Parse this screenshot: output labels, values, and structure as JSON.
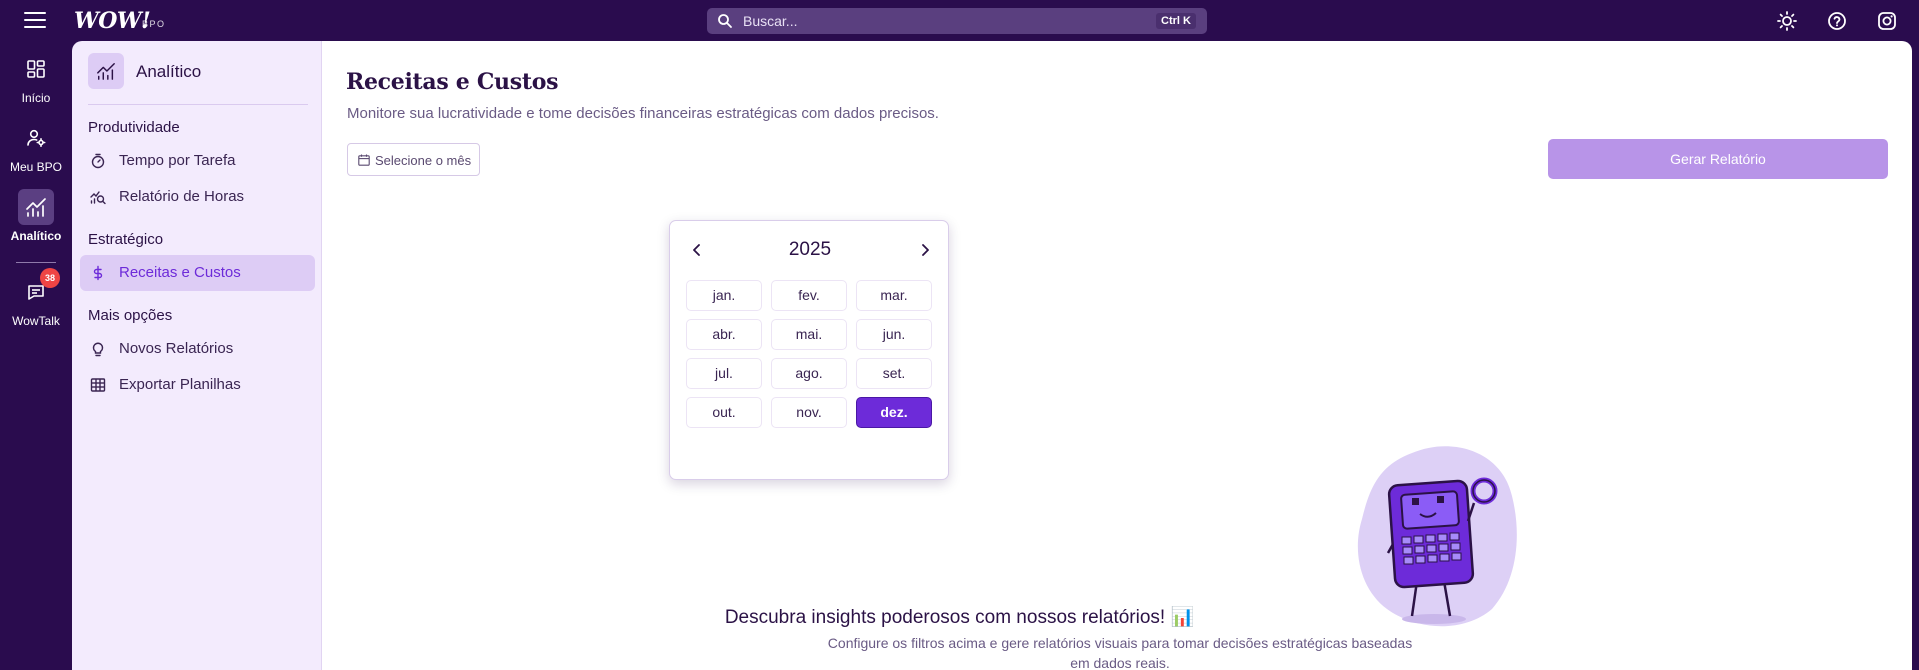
{
  "topbar": {
    "logo": "WOW!",
    "logo_sub": "BPO",
    "search_placeholder": "Buscar...",
    "shortcut": "Ctrl K",
    "icons": [
      "menu-icon",
      "sun-icon",
      "help-icon",
      "instagram-icon"
    ]
  },
  "rail": {
    "items": [
      {
        "label": "Início",
        "icon": "grid-icon"
      },
      {
        "label": "Meu BPO",
        "icon": "user-settings-icon"
      },
      {
        "label": "Analítico",
        "icon": "chart-icon"
      },
      {
        "label": "WowTalk",
        "icon": "chat-icon",
        "badge": "38"
      }
    ]
  },
  "sidebar": {
    "title": "Analítico",
    "sections": [
      {
        "title": "Produtividade",
        "items": [
          {
            "label": "Tempo por Tarefa",
            "icon": "timer-icon"
          },
          {
            "label": "Relatório de Horas",
            "icon": "search-chart-icon"
          }
        ]
      },
      {
        "title": "Estratégico",
        "items": [
          {
            "label": "Receitas e Custos",
            "icon": "dollar-icon",
            "active": true
          }
        ]
      },
      {
        "title": "Mais opções",
        "items": [
          {
            "label": "Novos Relatórios",
            "icon": "lightbulb-icon"
          },
          {
            "label": "Exportar Planilhas",
            "icon": "table-icon"
          }
        ]
      }
    ]
  },
  "main": {
    "title": "Receitas e Custos",
    "subtitle": "Monitore sua lucratividade e tome decisões financeiras estratégicas com dados precisos.",
    "month_button": "Selecione o mês",
    "generate_button": "Gerar Relatório",
    "picker": {
      "year": "2025",
      "months": [
        "jan.",
        "fev.",
        "mar.",
        "abr.",
        "mai.",
        "jun.",
        "jul.",
        "ago.",
        "set.",
        "out.",
        "nov.",
        "dez."
      ],
      "selected": "dez."
    },
    "empty_title": "Descubra insights poderosos com nossos relatórios! 📊",
    "empty_sub": "Configure os filtros acima e gere relatórios visuais para tomar decisões estratégicas baseadas em dados reais."
  },
  "colors": {
    "brand_dark": "#2a0c4e",
    "accent": "#6d2bd9",
    "button_disabled": "#b894e8",
    "sidebar_bg": "#f3ebfd",
    "badge": "#ef4444"
  }
}
